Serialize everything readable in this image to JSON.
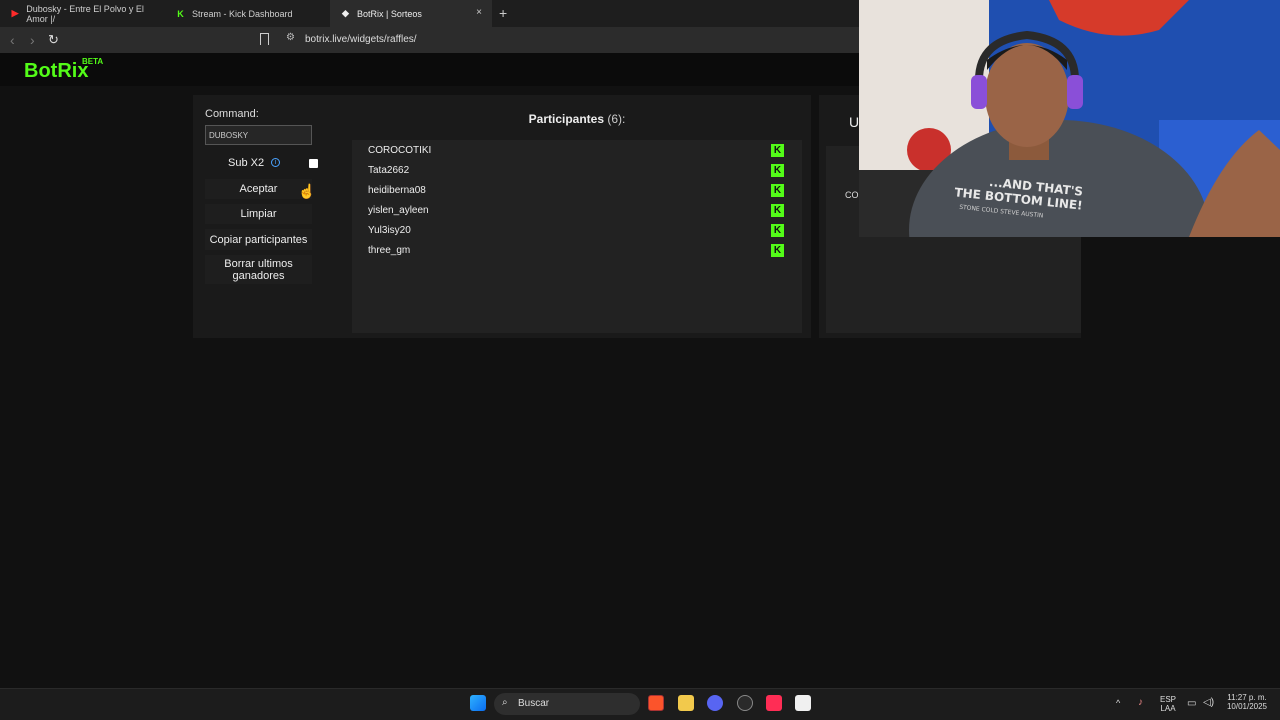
{
  "browser": {
    "tabs": [
      {
        "label": "Dubosky - Entre El Polvo y El Amor |/",
        "active": false
      },
      {
        "label": "Stream - Kick Dashboard",
        "active": false
      },
      {
        "label": "BotRix | Sorteos",
        "active": true
      }
    ],
    "new_tab_label": "+",
    "close_label": "×",
    "url": "botrix.live/widgets/raffles/"
  },
  "site": {
    "logo": "BotRix",
    "badge": "BETA",
    "brand_color": "#53fc18"
  },
  "raffle": {
    "command_label": "Command:",
    "command_value": "DUBOSKY",
    "sub_label": "Sub X2",
    "sub_checked": false,
    "buttons": {
      "accept": "Aceptar",
      "clear": "Limpiar",
      "copy": "Copiar participantes",
      "delete_winners": "Borrar ultimos ganadores"
    },
    "participants_title": "Participantes",
    "participants_count": "(6):",
    "participants": [
      "COROCOTIKI",
      "Tata2662",
      "heidiberna08",
      "yislen_ayleen",
      "Yul3isy20",
      "three_gm"
    ],
    "platform_icon": "kick-icon",
    "winners_title_partial": "U",
    "winners_partial_text": "CO"
  },
  "taskbar": {
    "search_placeholder": "Buscar",
    "lang_line1": "ESP",
    "lang_line2": "LAA",
    "time": "11:27 p. m.",
    "date": "10/01/2025"
  },
  "overlay": {
    "shirt_text_1": "...AND THAT'S",
    "shirt_text_2": "THE BOTTOM LINE!",
    "shirt_text_3": "STONE COLD STEVE AUSTIN"
  }
}
